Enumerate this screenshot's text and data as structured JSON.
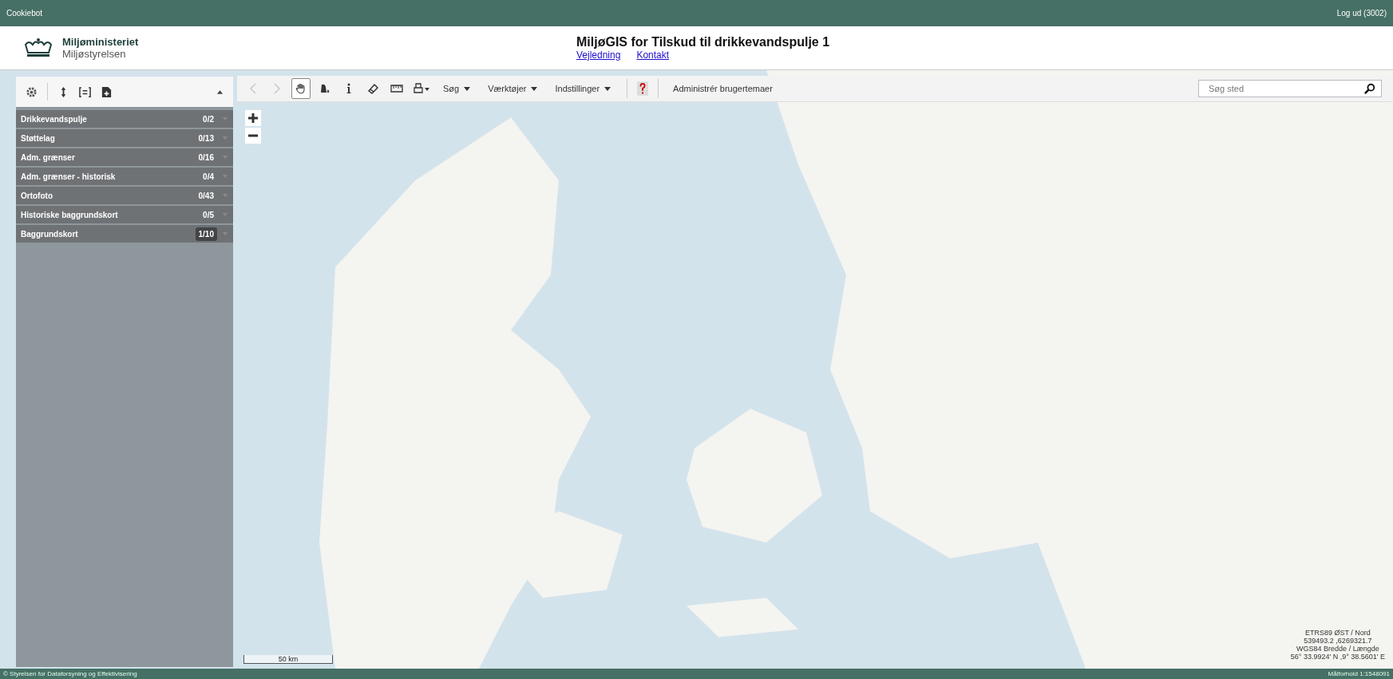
{
  "top_bar": {
    "left": "Cookiebot",
    "right": "Log ud (3002)"
  },
  "header": {
    "org_name": "Miljøministeriet",
    "org_sub": "Miljøstyrelsen",
    "title": "MiljøGIS for Tilskud til drikkevandspulje 1",
    "links": [
      "Vejledning",
      "Kontakt"
    ]
  },
  "layer_panel": {
    "layers": [
      {
        "name": "Drikkevandspulje",
        "count": "0/2",
        "active": false
      },
      {
        "name": "Støttelag",
        "count": "0/13",
        "active": false
      },
      {
        "name": "Adm. grænser",
        "count": "0/16",
        "active": false
      },
      {
        "name": "Adm. grænser - historisk",
        "count": "0/4",
        "active": false
      },
      {
        "name": "Ortofoto",
        "count": "0/43",
        "active": false
      },
      {
        "name": "Historiske baggrundskort",
        "count": "0/5",
        "active": false
      },
      {
        "name": "Baggrundskort",
        "count": "1/10",
        "active": true
      }
    ]
  },
  "toolbar": {
    "tools": [
      {
        "kind": "back",
        "disabled": true,
        "selected": false
      },
      {
        "kind": "forward",
        "disabled": true,
        "selected": false
      },
      {
        "kind": "pan",
        "disabled": false,
        "selected": true
      },
      {
        "kind": "select",
        "disabled": false,
        "selected": false
      },
      {
        "kind": "info",
        "disabled": false,
        "selected": false
      },
      {
        "kind": "eraser",
        "disabled": false,
        "selected": false
      },
      {
        "kind": "measure",
        "disabled": false,
        "selected": false
      },
      {
        "kind": "print",
        "disabled": false,
        "selected": false
      }
    ],
    "menus": [
      "Søg",
      "Værktøjer",
      "Indstillinger"
    ],
    "manage_button": "Administrér brugertemaer",
    "search": {
      "placeholder": "Søg sted"
    }
  },
  "map": {
    "scale_label": "50 km",
    "coordinates": [
      "ETRS89 ØST / Nord",
      "539493.2 ,6269321.7",
      "WGS84 Bredde / Længde",
      "56° 33.9924' N ,9° 38.5601' E"
    ]
  },
  "footer": {
    "left": "© Styrelsen for Dataforsyning og Effektivisering",
    "right": "Målforhold 1:1548091"
  }
}
